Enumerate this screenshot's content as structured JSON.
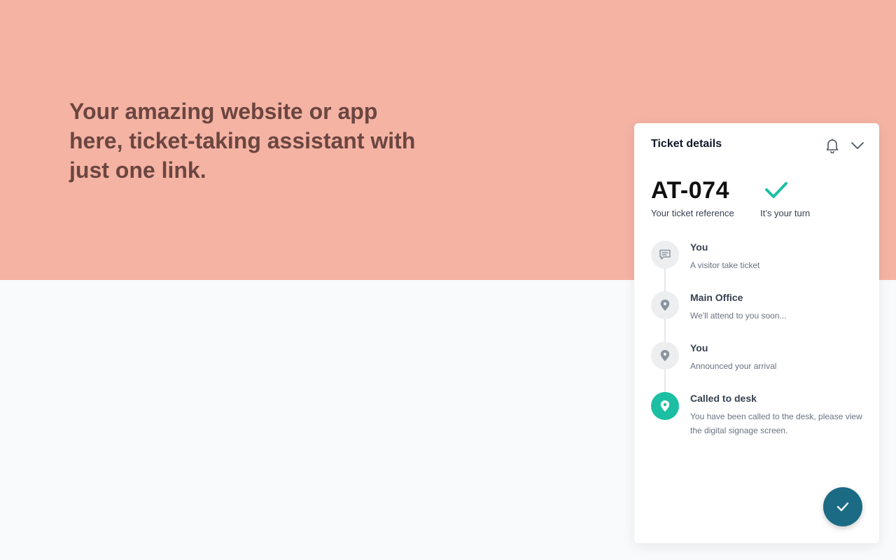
{
  "hero": {
    "headline": "Your amazing website or app here, ticket-taking assistant with just one link."
  },
  "panel": {
    "title": "Ticket details",
    "icons": {
      "bell": "bell-icon",
      "collapse": "chevron-down-icon",
      "turn": "check-icon",
      "confirm": "check-icon"
    },
    "ticket_reference": "AT-074",
    "ticket_reference_label": "Your ticket reference",
    "turn_label": "It’s your turn",
    "steps": [
      {
        "title": "You",
        "description": "A visitor take ticket",
        "icon": "message-icon"
      },
      {
        "title": "Main Office",
        "description": "We'll attend to you soon...",
        "icon": "location-pin-icon"
      },
      {
        "title": "You",
        "description": "Announced your arrival",
        "icon": "location-pin-icon"
      },
      {
        "title": "Called to desk",
        "description": "You have been called to the desk, please view the digital signage screen.",
        "icon": "location-pin-icon"
      }
    ]
  },
  "colors": {
    "hero_background": "#f5b3a4",
    "hero_text": "#6b4640",
    "accent_teal": "#1cbfa3",
    "fab_background": "#1c6b85"
  }
}
